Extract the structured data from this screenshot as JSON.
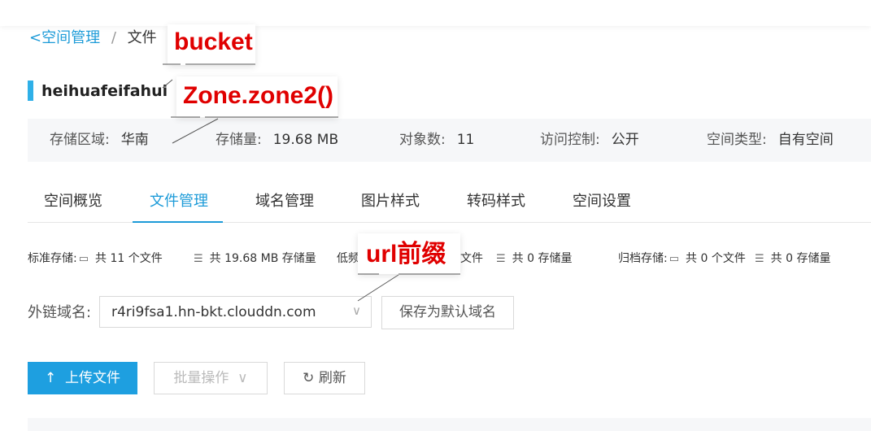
{
  "breadcrumb": {
    "back_icon": "chevron-left-icon",
    "parent": "空间管理",
    "separator": "/",
    "current": "文件"
  },
  "bucket": {
    "name": "heihuafeifahui"
  },
  "info": [
    {
      "label": "存储区域:",
      "value": "华南"
    },
    {
      "label": "存储量:",
      "value": "19.68 MB"
    },
    {
      "label": "对象数:",
      "value": "11"
    },
    {
      "label": "访问控制:",
      "value": "公开"
    },
    {
      "label": "空间类型:",
      "value": "自有空间"
    }
  ],
  "tabs": [
    {
      "label": "空间概览",
      "active": false
    },
    {
      "label": "文件管理",
      "active": true
    },
    {
      "label": "域名管理",
      "active": false
    },
    {
      "label": "图片样式",
      "active": false
    },
    {
      "label": "转码样式",
      "active": false
    },
    {
      "label": "空间设置",
      "active": false
    }
  ],
  "storage": {
    "standard_label": "标准存储:",
    "standard_files": "共 11 个文件",
    "standard_size": "共 19.68 MB 存储量",
    "low_label": "低频",
    "low_files": "文件",
    "low_size": "共 0 存储量",
    "archive_label": "归档存储:",
    "archive_files": "共 0 个文件",
    "archive_size": "共 0 存储量"
  },
  "domain": {
    "label": "外链域名:",
    "value": "r4ri9fsa1.hn-bkt.clouddn.com",
    "set_default_label": "保存为默认域名"
  },
  "toolbar": {
    "upload_label": "上传文件",
    "batch_label": "批量操作",
    "refresh_label": "刷新"
  },
  "annotations": {
    "bucket": "bucket",
    "zone": "Zone.zone2()",
    "url_prefix": "url前缀"
  },
  "colors": {
    "accent": "#1d9bd8",
    "annotation": "#e00000"
  }
}
